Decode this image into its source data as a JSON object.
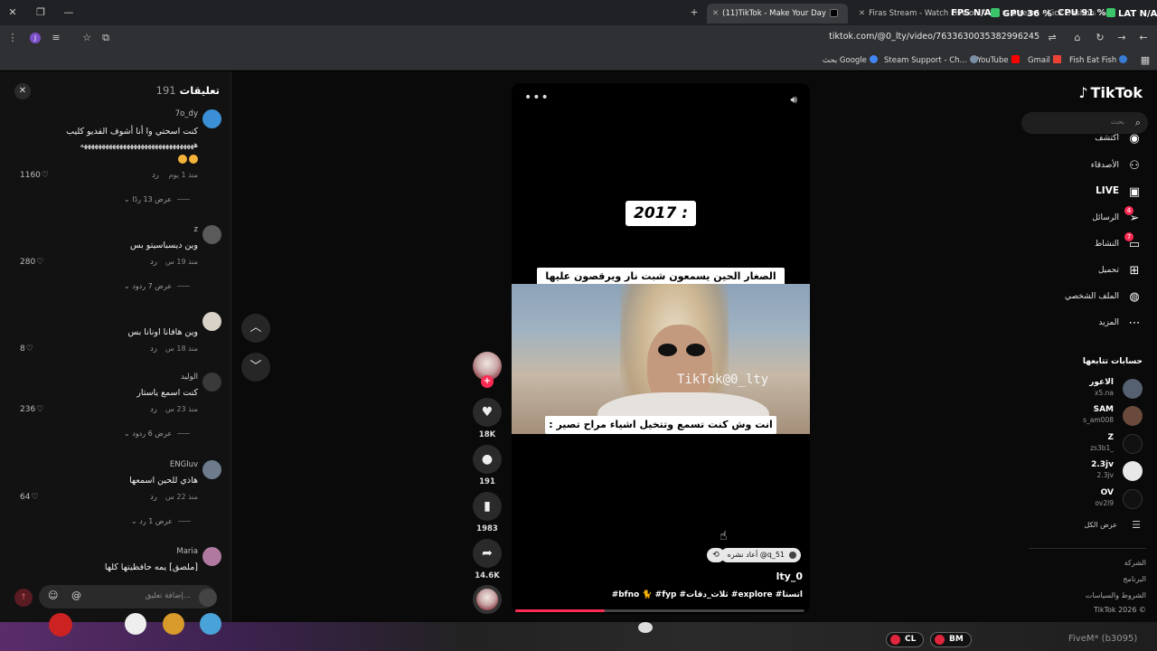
{
  "browser": {
    "tabs": [
      {
        "title": "(11)TikTok - Make Your Day",
        "active": true
      },
      {
        "title": "Firas Stream - Watch Live on K",
        "active": false
      },
      {
        "title": "Stream - Kick Dashboard",
        "active": false
      }
    ],
    "overlay": {
      "fps": "FPS N/A",
      "gpu": "GPU 36 %",
      "cpu": "CPU 91 %",
      "lat": "LAT N/A"
    },
    "url": "tiktok.com/@0_lty/video/7633630035382996245",
    "profile_initial": "J",
    "bookmarks": [
      {
        "label": "بحث Google",
        "color": "#4285f4"
      },
      {
        "label": "Steam Support - Ch...",
        "color": "#1b2838"
      },
      {
        "label": "YouTube",
        "color": "#ff0000"
      },
      {
        "label": "Gmail",
        "color": "#ea4335"
      },
      {
        "label": "Fish Eat Fish",
        "color": "#3a7bd5"
      }
    ]
  },
  "comments": {
    "title": "تعليقات",
    "count": "191",
    "input_placeholder": "إضافة تعليق...",
    "at_symbol": "@",
    "items": [
      {
        "user": "7o_dy",
        "line1": "كنت اسحتي وا أنا أشوف الفديو كليب",
        "line2": "ههههههههههههههههههههههههههههههههه",
        "time": "منذ 1 يوم",
        "reply": "رد",
        "likes": "1160",
        "more": "عرض 13 ردًا",
        "avatar_color": "#3a8fd6"
      },
      {
        "user": "z",
        "line1": "وين ديسباسيتو بس",
        "time": "منذ 19 س",
        "reply": "رد",
        "likes": "280",
        "more": "عرض 7 ردود",
        "avatar_color": "#5a5a5a"
      },
      {
        "user": "",
        "line1": "وين هافانا اونانا بس",
        "time": "منذ 18 س",
        "reply": "رد",
        "likes": "8",
        "more": "",
        "avatar_color": "#d8d2c8"
      },
      {
        "user": "الوليد",
        "line1": "كنت اسمع ياستار",
        "time": "منذ 23 س",
        "reply": "رد",
        "likes": "236",
        "more": "عرض 6 ردود",
        "avatar_color": "#3a3a3a"
      },
      {
        "user": "ENGluv",
        "line1": "هاذي للحين اسمعها",
        "time": "منذ 22 س",
        "reply": "رد",
        "likes": "64",
        "more": "عرض 1 رد",
        "avatar_color": "#6d7b8c"
      },
      {
        "user": "Maria",
        "line1": "[ملصق] يمه حافظيتها كلها",
        "time": "",
        "reply": "",
        "likes": "",
        "more": "",
        "avatar_color": "#b07aa0"
      }
    ]
  },
  "video": {
    "year_label": "2017 :",
    "caption_top": "الصغار الحين يسمعون شبت نار ويرقصون عليها",
    "watermark": "TikTok@0_lty",
    "caption_bottom": "انت وش كنت تسمع وتتخيل اشياء مراح تصير :",
    "repost_label": "q_51@ أعاد نشره",
    "author": "lty_0",
    "description": "#bfno 🐈 #fyp #ثلاث_دقات #explore #اتستا",
    "progress": 0.31
  },
  "actions": {
    "likes": "18K",
    "comments": "191",
    "saves": "1983",
    "shares": "14.6K"
  },
  "sidebar": {
    "logo": "TikTok",
    "search_placeholder": "بحث",
    "nav": [
      {
        "label": "اكتشف",
        "icon": "compass-icon"
      },
      {
        "label": "الأصدقاء",
        "icon": "friends-icon"
      },
      {
        "label": "LIVE",
        "icon": "live-icon"
      },
      {
        "label": "الرسائل",
        "icon": "messages-icon",
        "badge": "4"
      },
      {
        "label": "النشاط",
        "icon": "activity-icon",
        "badge": "7"
      },
      {
        "label": "تحميل",
        "icon": "upload-icon"
      },
      {
        "label": "الملف الشخصي",
        "icon": "profile-icon"
      },
      {
        "label": "المزيد",
        "icon": "more-icon"
      }
    ],
    "following_title": "حسابات تتابعها",
    "accounts": [
      {
        "name": "الاعور",
        "handle": "x5.na",
        "color": "#556070"
      },
      {
        "name": "SAM",
        "handle": "s_am008",
        "color": "#6a4a3a"
      },
      {
        "name": "Z",
        "handle": "zs3b1_",
        "color": "#111111"
      },
      {
        "name": "2.3jv",
        "handle": "2.3jv",
        "color": "#e8e8e8"
      },
      {
        "name": "OV",
        "handle": "ov2l9",
        "color": "#111111"
      }
    ],
    "see_all": "عرض الكل",
    "footer": [
      "الشركة",
      "البرنامج",
      "الشروط والسياسات",
      "© TikTok 2026"
    ]
  },
  "hud": {
    "cl": "CL",
    "bm": "BM",
    "brand": "FiveM* (b3095)"
  }
}
